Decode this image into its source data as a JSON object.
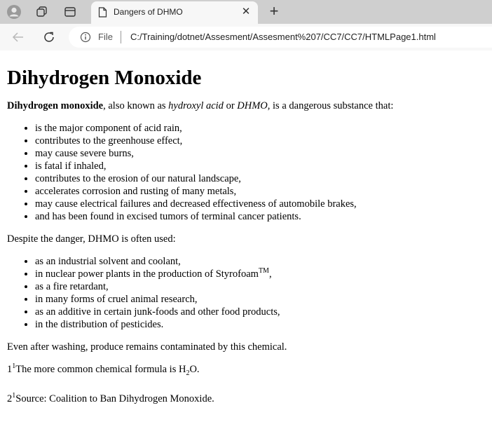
{
  "browser": {
    "tab_title": "Dangers of DHMO",
    "address_scheme": "File",
    "address_url": "C:/Training/dotnet/Assesment/Assesment%207/CC7/CC7/HTMLPage1.html"
  },
  "page": {
    "heading": "Dihydrogen Monoxide",
    "intro": {
      "bold": "Dihydrogen monoxide",
      "t1": ", also known as ",
      "em1": "hydroxyl acid",
      "t2": " or ",
      "em2": "DHMO",
      "t3": ", is a dangerous substance that:"
    },
    "dangers": [
      "is the major component of acid rain,",
      "contributes to the greenhouse effect,",
      "may cause severe burns,",
      "is fatal if inhaled,",
      "contributes to the erosion of our natural landscape,",
      "accelerates corrosion and rusting of many metals,",
      "may cause electrical failures and decreased effectiveness of automobile brakes,",
      "and has been found in excised tumors of terminal cancer patients."
    ],
    "uses_intro": "Despite the danger, DHMO is often used:",
    "uses": {
      "u1": "as an industrial solvent and coolant,",
      "u2_text": "in nuclear power plants in the production of Styrofoam",
      "u2_sup": "TM",
      "u2_tail": ",",
      "u3": "as a fire retardant,",
      "u4": "in many forms of cruel animal research,",
      "u5": "as an additive in certain junk-foods and other food products,",
      "u6": "in the distribution of pesticides."
    },
    "washing": "Even after washing, produce remains contaminated by this chemical.",
    "footnote1": {
      "num": "1",
      "sup": "1",
      "text": "The more common chemical formula is H",
      "sub": "2",
      "tail": "O."
    },
    "footnote2": {
      "num": "2",
      "sup": "1",
      "text": "Source: Coalition to Ban Dihydrogen Monoxide."
    }
  }
}
